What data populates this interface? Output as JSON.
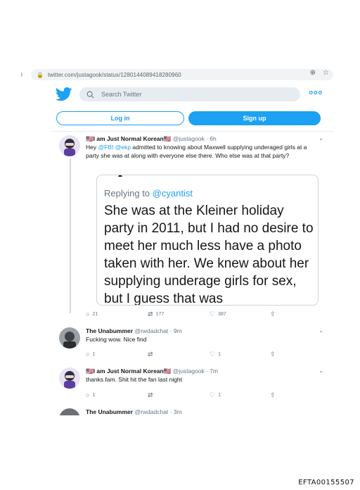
{
  "browser": {
    "url": "twitter.com/justagook/status/1280144089418280960",
    "left_indicator": "l"
  },
  "twitter": {
    "search_placeholder": "Search Twitter",
    "more_label": "ooo",
    "login_label": "Log in",
    "signup_label": "Sign up"
  },
  "colors": {
    "brand_blue": "#1da1f2",
    "muted_gray": "#657786"
  },
  "tweets": [
    {
      "name": "🇺🇸I am Just Normal Korean🇺🇸",
      "handle": "@justagook · 6h",
      "text_pre": "Hey ",
      "mention1": "@FBI",
      "mention2": "@ekp",
      "text_post": " admitted to knowing about Maxwell supplying underaged girls at a party she was at along with everyone else there. Who else was at that party?",
      "replies": "21",
      "retweets": "177",
      "likes": "387"
    },
    {
      "name": "The Unabummer",
      "handle": "@rwdadchat · 9m",
      "text": "Fucking wow. Nice find",
      "replies": "1",
      "likes": "1"
    },
    {
      "name": "🇺🇸I am Just Normal Korean🇺🇸",
      "handle": "@justagook · 7m",
      "text": "thanks fam. Shit hit the fan last night",
      "replies": "1",
      "likes": "1"
    }
  ],
  "quote": {
    "replying_to_prefix": "Replying to ",
    "replying_to_handle": "@cyantist",
    "text": "She was at the Kleiner holiday party in 2011, but I had no desire to meet her much less have a photo taken with her. We knew about her supplying underage girls for sex, but I guess that was"
  },
  "cutoff_tweet": {
    "name": "The Unabummer",
    "handle": "@rwdadchat · 3m"
  },
  "footer": {
    "doc_id": "EFTA00155507"
  }
}
